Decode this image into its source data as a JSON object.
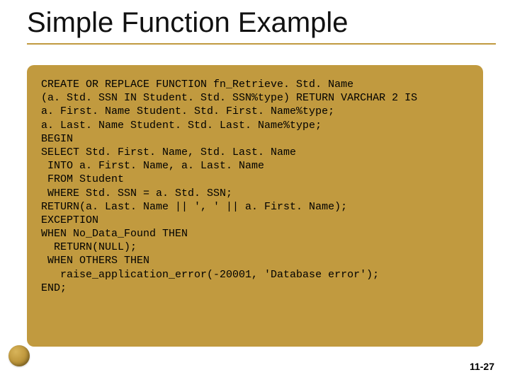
{
  "slide": {
    "title": "Simple Function Example",
    "page_number": "11-27"
  },
  "code_lines": [
    "CREATE OR REPLACE FUNCTION fn_Retrieve. Std. Name",
    "(a. Std. SSN IN Student. Std. SSN%type) RETURN VARCHAR 2 IS",
    "a. First. Name Student. Std. First. Name%type;",
    "a. Last. Name Student. Std. Last. Name%type;",
    "BEGIN",
    "SELECT Std. First. Name, Std. Last. Name",
    " INTO a. First. Name, a. Last. Name",
    " FROM Student",
    " WHERE Std. SSN = a. Std. SSN;",
    "RETURN(a. Last. Name || ', ' || a. First. Name);",
    "EXCEPTION",
    "WHEN No_Data_Found THEN",
    "  RETURN(NULL);",
    " WHEN OTHERS THEN",
    "   raise_application_error(-20001, 'Database error');",
    "END;"
  ]
}
